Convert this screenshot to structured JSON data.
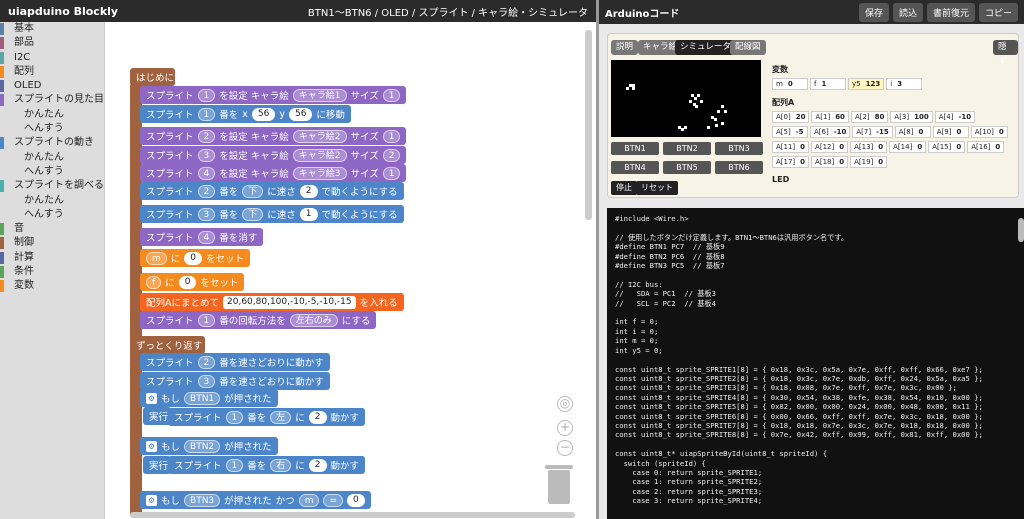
{
  "app": {
    "title": "uiapduino Blockly",
    "breadcrumb": "BTN1～BTN6 / OLED / スプライト / キャラ絵・シミュレータ"
  },
  "toolbox": [
    {
      "label": "基本",
      "color": "#5b80a5",
      "sub": false
    },
    {
      "label": "部品",
      "color": "#a55b80",
      "sub": false
    },
    {
      "label": "I2C",
      "color": "#5ba5a5",
      "sub": false
    },
    {
      "label": "配列",
      "color": "#f58a1f",
      "sub": false
    },
    {
      "label": "OLED",
      "color": "#5b67a5",
      "sub": false
    },
    {
      "label": "スプライトの見た目",
      "color": "#8e67c4",
      "sub": false
    },
    {
      "label": "かんたん",
      "color": "",
      "sub": true
    },
    {
      "label": "へんすう",
      "color": "",
      "sub": true
    },
    {
      "label": "スプライトの動き",
      "color": "#4c86c9",
      "sub": false
    },
    {
      "label": "かんたん",
      "color": "",
      "sub": true
    },
    {
      "label": "へんすう",
      "color": "",
      "sub": true
    },
    {
      "label": "スプライトを調べる",
      "color": "#4cb0b0",
      "sub": false
    },
    {
      "label": "かんたん",
      "color": "",
      "sub": true
    },
    {
      "label": "へんすう",
      "color": "",
      "sub": true
    },
    {
      "label": "音",
      "color": "#5ba55b",
      "sub": false
    },
    {
      "label": "制御",
      "color": "#a0613f",
      "sub": false
    },
    {
      "label": "計算",
      "color": "#5b67a5",
      "sub": false
    },
    {
      "label": "条件",
      "color": "#5ba55b",
      "sub": false
    },
    {
      "label": "変数",
      "color": "#f58a1f",
      "sub": false
    }
  ],
  "blocks": {
    "hajime": "はじめに",
    "b1": [
      "スプライト",
      "1",
      "を設定 キャラ絵",
      "キャラ絵1",
      "サイズ",
      "1"
    ],
    "b2": [
      "スプライト",
      "1",
      "番を",
      "x",
      "56",
      "y",
      "56",
      "に移動"
    ],
    "b3": [
      "スプライト",
      "2",
      "を設定 キャラ絵",
      "キャラ絵2",
      "サイズ",
      "1"
    ],
    "b4": [
      "スプライト",
      "3",
      "を設定 キャラ絵",
      "キャラ絵2",
      "サイズ",
      "2"
    ],
    "b5": [
      "スプライト",
      "4",
      "を設定 キャラ絵",
      "キャラ絵3",
      "サイズ",
      "1"
    ],
    "b6": [
      "スプライト",
      "2",
      "番を",
      "下",
      "に速さ",
      "2",
      "で動くようにする"
    ],
    "b7": [
      "スプライト",
      "3",
      "番を",
      "下",
      "に速さ",
      "1",
      "で動くようにする"
    ],
    "b8": [
      "スプライト",
      "4",
      "番を消す"
    ],
    "b9": [
      "m",
      "に",
      "0",
      "をセット"
    ],
    "b10": [
      "f",
      "に",
      "0",
      "をセット"
    ],
    "b11": [
      "配列Aにまとめて",
      "20,60,80,100,-10,-5,-10,-15",
      "を入れる"
    ],
    "b12": [
      "スプライト",
      "1",
      "番の回転方法を",
      "左右のみ",
      "にする"
    ],
    "loop": "ずっとくり返す",
    "b13": [
      "スプライト",
      "2",
      "番を速さどおりに動かす"
    ],
    "b14": [
      "スプライト",
      "3",
      "番を速さどおりに動かす"
    ],
    "if1": [
      "もし",
      "BTN1",
      "が押された"
    ],
    "then": "実行",
    "b15": [
      "スプライト",
      "1",
      "番を",
      "左",
      "に",
      "2",
      "動かす"
    ],
    "if2": [
      "もし",
      "BTN2",
      "が押された"
    ],
    "b16": [
      "スプライト",
      "1",
      "番を",
      "右",
      "に",
      "2",
      "動かす"
    ],
    "if3": [
      "もし",
      "BTN3",
      "が押された",
      "かつ",
      "m",
      "=",
      "0"
    ]
  },
  "panel": {
    "title": "Arduinoコード",
    "buttons": [
      "保存",
      "読込",
      "書前復元",
      "コピー"
    ],
    "tabs": [
      "説明",
      "キャラ絵",
      "シミュレータ",
      "配線図"
    ],
    "hide": "隠す",
    "btns": [
      "BTN1",
      "BTN2",
      "BTN3",
      "BTN4",
      "BTN5",
      "BTN6"
    ],
    "stop": "停止",
    "reset": "リセット",
    "vars_label": "変数",
    "vars": [
      [
        "m",
        "0"
      ],
      [
        "f",
        "1"
      ],
      [
        "y5",
        "123"
      ],
      [
        "i",
        "3"
      ]
    ],
    "arr_label": "配列A",
    "arr": [
      [
        "A[0]",
        "20"
      ],
      [
        "A[1]",
        "60"
      ],
      [
        "A[2]",
        "80"
      ],
      [
        "A[3]",
        "100"
      ],
      [
        "A[4]",
        "-10"
      ],
      [
        "A[5]",
        "-5"
      ],
      [
        "A[6]",
        "-10"
      ],
      [
        "A[7]",
        "-15"
      ],
      [
        "A[8]",
        "0"
      ],
      [
        "A[9]",
        "0"
      ],
      [
        "A[10]",
        "0"
      ],
      [
        "A[11]",
        "0"
      ],
      [
        "A[12]",
        "0"
      ],
      [
        "A[13]",
        "0"
      ],
      [
        "A[14]",
        "0"
      ],
      [
        "A[15]",
        "0"
      ],
      [
        "A[16]",
        "0"
      ],
      [
        "A[17]",
        "0"
      ],
      [
        "A[18]",
        "0"
      ],
      [
        "A[19]",
        "0"
      ]
    ],
    "led": "LED"
  },
  "code": "#include <Wire.h>\n\n// 使用したボタンだけ定義します。BTN1～BTN6は汎用ボタン名です。\n#define BTN1 PC7  // 基板9\n#define BTN2 PC6  // 基板8\n#define BTN3 PC5  // 基板7\n\n// I2C bus:\n//   SDA = PC1  // 基板3\n//   SCL = PC2  // 基板4\n\nint f = 0;\nint i = 0;\nint m = 0;\nint y5 = 0;\n\nconst uint8_t sprite_SPRITE1[8] = { 0x18, 0x3c, 0x5a, 0x7e, 0xff, 0xff, 0x66, 0xe7 };\nconst uint8_t sprite_SPRITE2[8] = { 0x18, 0x3c, 0x7e, 0xdb, 0xff, 0x24, 0x5a, 0xa5 };\nconst uint8_t sprite_SPRITE3[8] = { 0x18, 0x08, 0x7e, 0xff, 0x7e, 0x3c, 0x00 };\nconst uint8_t sprite_SPRITE4[8] = { 0x30, 0x54, 0x38, 0xfe, 0x38, 0x54, 0x10, 0x00 };\nconst uint8_t sprite_SPRITE5[8] = { 0x82, 0x00, 0x00, 0x24, 0x00, 0x48, 0x00, 0x11 };\nconst uint8_t sprite_SPRITE6[8] = { 0x00, 0x66, 0xff, 0xff, 0x7e, 0x3c, 0x18, 0x00 };\nconst uint8_t sprite_SPRITE7[8] = { 0x18, 0x18, 0x7e, 0x3c, 0x7e, 0x18, 0x18, 0x00 };\nconst uint8_t sprite_SPRITE8[8] = { 0x7e, 0x42, 0xff, 0x99, 0xff, 0x81, 0xff, 0x00 };\n\nconst uint8_t* uiapSpriteById(uint8_t spriteId) {\n  switch (spriteId) {\n    case 0: return sprite_SPRITE1;\n    case 1: return sprite_SPRITE2;\n    case 2: return sprite_SPRITE3;\n    case 3: return sprite_SPRITE4;"
}
